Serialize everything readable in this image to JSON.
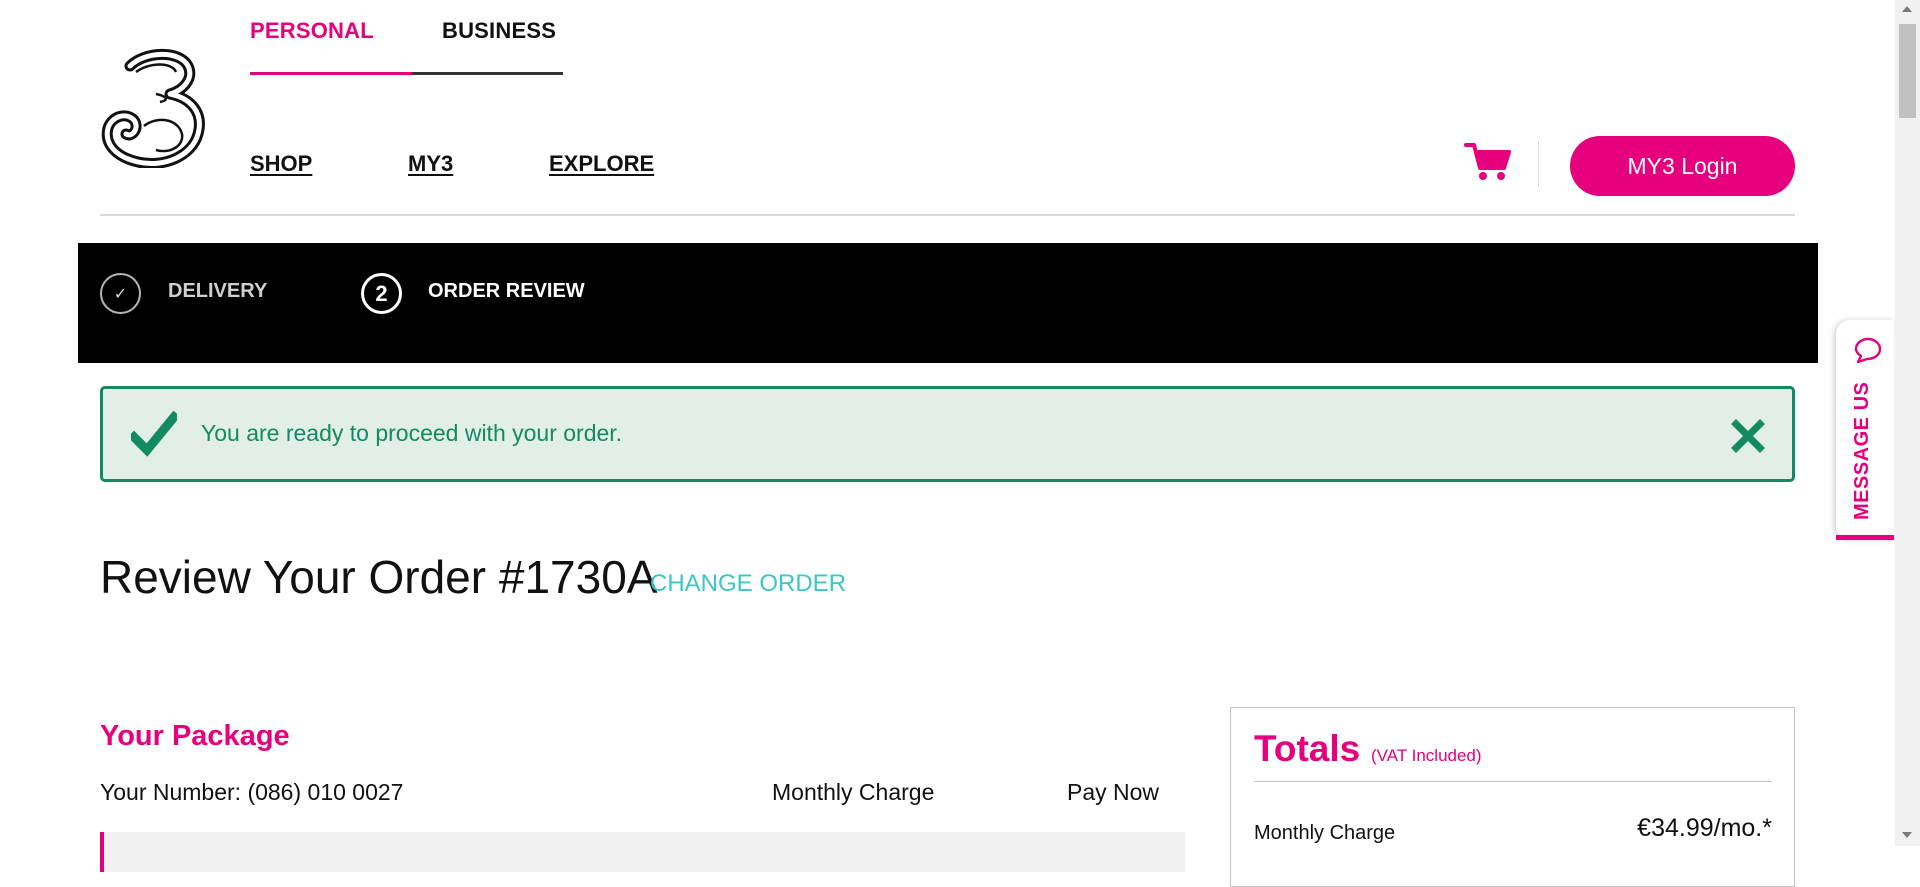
{
  "brand": {
    "logo_icon": "three-logo-icon",
    "accent_color": "#e6007e",
    "success_color": "#138a61",
    "link_color": "#3cc6c7"
  },
  "segment_tabs": {
    "personal": "PERSONAL",
    "business": "BUSINESS",
    "active": "PERSONAL"
  },
  "main_nav": {
    "shop": "SHOP",
    "my3": "MY3",
    "explore": "EXPLORE"
  },
  "header_actions": {
    "cart_icon": "shopping-cart-icon",
    "login_label": "MY3 Login"
  },
  "checkout_steps": [
    {
      "number": "✓",
      "label": "DELIVERY",
      "state": "completed"
    },
    {
      "number": "2",
      "label": "ORDER REVIEW",
      "state": "current"
    }
  ],
  "alert": {
    "message": "You are ready to proceed with your order.",
    "icon": "checkmark-icon",
    "close_icon": "close-x-icon"
  },
  "review": {
    "title": "Review Your Order #1730A",
    "change_link": "CHANGE ORDER"
  },
  "package": {
    "title": "Your Package",
    "number_line": "Your Number: (086) 010 0027",
    "col_monthly": "Monthly Charge",
    "col_paynow": "Pay Now"
  },
  "totals": {
    "title": "Totals",
    "vat_note": "(VAT Included)",
    "monthly_label": "Monthly Charge",
    "monthly_value": "€34.99/mo.*"
  },
  "message_us": {
    "label": "MESSAGE US",
    "icon": "chat-bubble-icon"
  }
}
